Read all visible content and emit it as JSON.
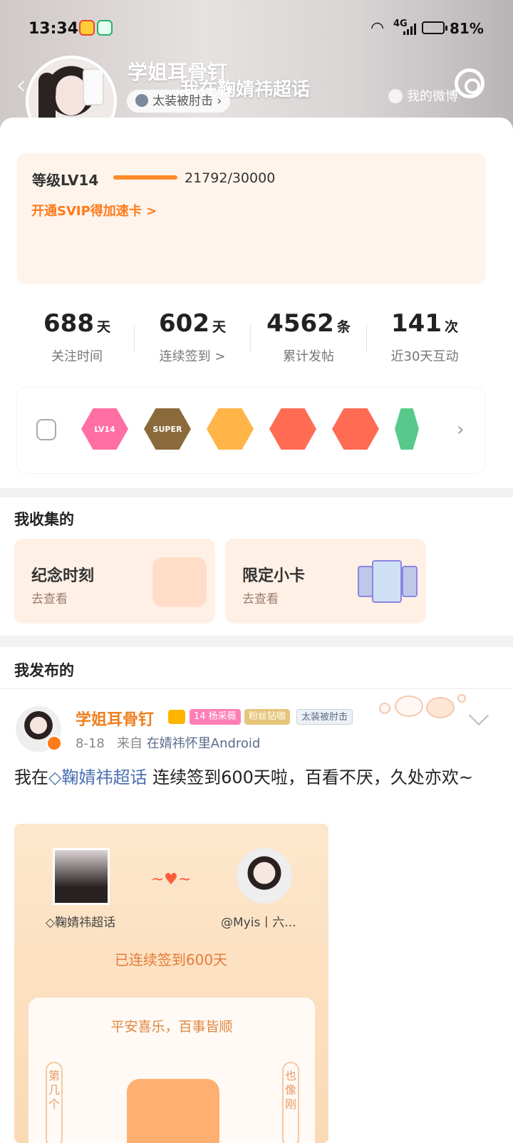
{
  "status_bar": {
    "time": "13:34",
    "network": "4G",
    "battery": "81%"
  },
  "profile": {
    "username": "学姐耳骨钉",
    "banner_text": "我在鞠婧祎超话",
    "tag": "太装被肘击",
    "my_weibo_label": "我的微博"
  },
  "level": {
    "label": "等级LV14",
    "progress_text": "21792/30000",
    "progress": 0.7264,
    "upgrade_link": "开通SVIP得加速卡 >"
  },
  "stats": [
    {
      "value": "688",
      "unit": "天",
      "label": "关注时间"
    },
    {
      "value": "602",
      "unit": "天",
      "label": "连续签到 >"
    },
    {
      "value": "4562",
      "unit": "条",
      "label": "累计发帖"
    },
    {
      "value": "141",
      "unit": "次",
      "label": "近30天互动"
    }
  ],
  "badges": [
    {
      "text": "LV14",
      "color": "#ff6fa3"
    },
    {
      "text": "SUPER",
      "color": "#8a6a3a"
    },
    {
      "text": "",
      "color": "#ffb547"
    },
    {
      "text": "",
      "color": "#ff6b53"
    },
    {
      "text": "",
      "color": "#ff6b53"
    },
    {
      "text": "",
      "color": "#58c98a"
    }
  ],
  "collections": {
    "title": "我收集的",
    "items": [
      {
        "title": "纪念时刻",
        "sub": "去查看"
      },
      {
        "title": "限定小卡",
        "sub": "去查看"
      }
    ]
  },
  "posts": {
    "title": "我发布的",
    "item": {
      "name": "学姐耳骨钉",
      "badge_fan": "14 杨采薇",
      "badge_diamond": "粉丝钻咖",
      "badge_tag": "太装被肘击",
      "date": "8-18",
      "from_prefix": "来自",
      "source": "在婧祎怀里Android",
      "text_prefix": "我在",
      "topic": "鞠婧祎超话",
      "text_rest": " 连续签到600天啦，百看不厌，久处亦欢~",
      "card": {
        "left_label": "鞠婧祎超话",
        "right_label": "@Myis丨六...",
        "days_text": "已连续签到600天",
        "wish": "平安喜乐，百事皆顺",
        "side_left": "第几个",
        "side_right": "也像刚"
      }
    }
  },
  "colors": {
    "accent": "#ff7a1a",
    "topic": "#4a6fb0"
  }
}
